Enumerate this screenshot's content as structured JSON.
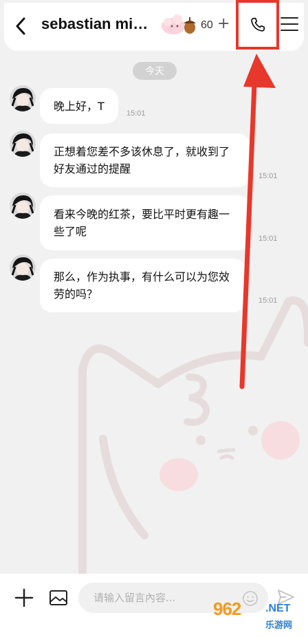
{
  "header": {
    "title": "sebastian mi…",
    "points": "60",
    "plus": "+"
  },
  "chat": {
    "date_label": "今天",
    "messages": [
      {
        "text": "晚上好，T",
        "time": "15:01"
      },
      {
        "text": "正想着您差不多该休息了，就收到了好友通过的提醒",
        "time": "15:01"
      },
      {
        "text": "看来今晚的红茶，要比平时更有趣一些了呢",
        "time": "15:01"
      },
      {
        "text": "那么，作为执事，有什么可以为您效劳的吗？",
        "time": "15:01"
      }
    ]
  },
  "input": {
    "placeholder": "请输入留言內容..."
  },
  "watermark": {
    "logo": "962",
    "net": ".NET",
    "sub": "乐游网"
  },
  "colors": {
    "highlight": "#e8372b",
    "background": "#f1f1f1",
    "bubble": "#ffffff"
  },
  "icons": {
    "back": "chevron-left-icon",
    "call": "phone-icon",
    "menu": "hamburger-menu-icon",
    "add": "plus-icon",
    "image": "image-icon",
    "emoji": "smiley-icon",
    "send": "paper-plane-icon"
  }
}
